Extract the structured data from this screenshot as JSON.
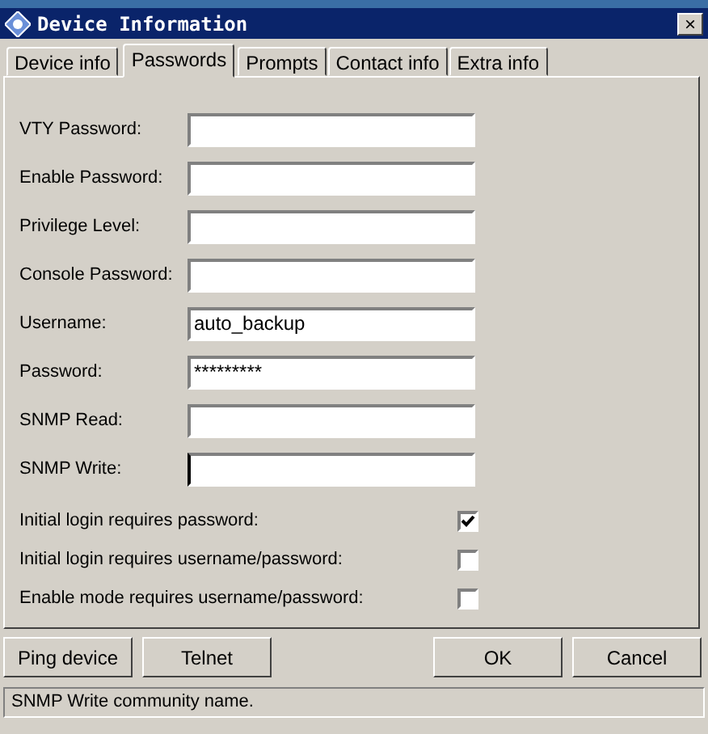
{
  "window": {
    "title": "Device Information",
    "close": "×"
  },
  "tabs": [
    {
      "label": "Device info",
      "selected": false
    },
    {
      "label": "Passwords",
      "selected": true
    },
    {
      "label": "Prompts",
      "selected": false
    },
    {
      "label": "Contact info",
      "selected": false
    },
    {
      "label": "Extra info",
      "selected": false
    }
  ],
  "fields": [
    {
      "label": "VTY Password:"
    },
    {
      "label": "Enable Password:"
    },
    {
      "label": "Privilege Level:"
    },
    {
      "label": "Console Password:"
    },
    {
      "label": "Username:",
      "value": "auto_backup"
    },
    {
      "label": "Password:",
      "value": "*********"
    },
    {
      "label": "SNMP Read:"
    },
    {
      "label": "SNMP Write:",
      "focused": true
    }
  ],
  "options": [
    {
      "label": "Initial login requires password:",
      "checked": true
    },
    {
      "label": "Initial login requires username/password:",
      "checked": false
    },
    {
      "label": "Enable mode requires username/password:",
      "checked": false
    }
  ],
  "buttons_left": [
    "Ping device",
    "Telnet"
  ],
  "buttons_right": [
    "OK",
    "Cancel"
  ],
  "status_bar": "SNMP Write community name."
}
